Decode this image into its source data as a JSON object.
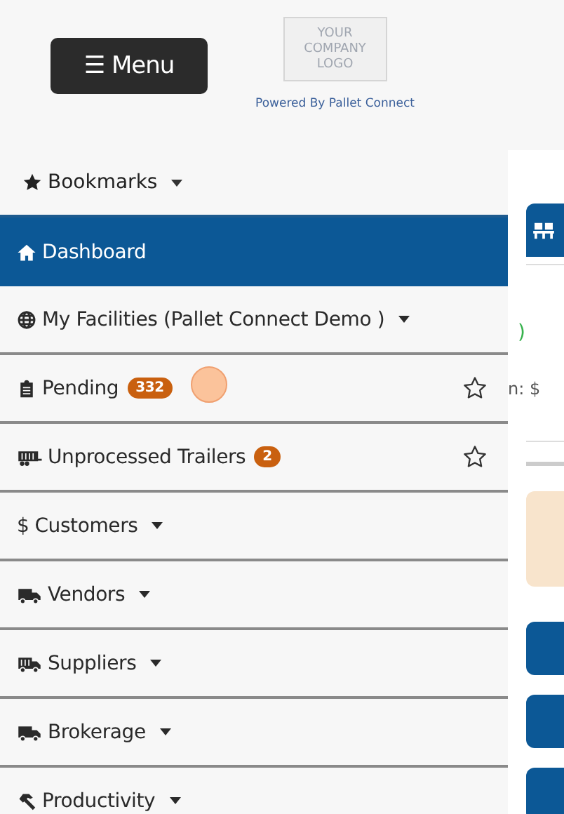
{
  "header": {
    "menu_button": {
      "icon": "☰",
      "label": "Menu"
    },
    "logo": {
      "lines": [
        "YOUR",
        "COMPANY",
        "LOGO"
      ]
    },
    "powered_by": "Powered By Pallet Connect"
  },
  "bookmarks": {
    "label": "Bookmarks",
    "dropdown": true
  },
  "sidebar": {
    "items": [
      {
        "label": "Dashboard",
        "selected": true,
        "dropdown": false
      },
      {
        "label": "My Facilities  (Pallet Connect Demo )",
        "selected": false,
        "dropdown": true
      },
      {
        "label": "Pending",
        "selected": false,
        "dropdown": false,
        "badge": "332",
        "bookmarked": false
      },
      {
        "label": "Unprocessed Trailers",
        "selected": false,
        "dropdown": false,
        "badge": "2",
        "bookmarked": false
      },
      {
        "label": "Customers",
        "icon_text": "$",
        "selected": false,
        "dropdown": true
      },
      {
        "label": "Vendors",
        "selected": false,
        "dropdown": true
      },
      {
        "label": "Suppliers",
        "selected": false,
        "dropdown": true
      },
      {
        "label": "Brokerage",
        "selected": false,
        "dropdown": true
      },
      {
        "label": "Productivity",
        "selected": false,
        "dropdown": true
      }
    ]
  },
  "content": {
    "status_fragment": ")",
    "label_fragment": "n: $"
  }
}
